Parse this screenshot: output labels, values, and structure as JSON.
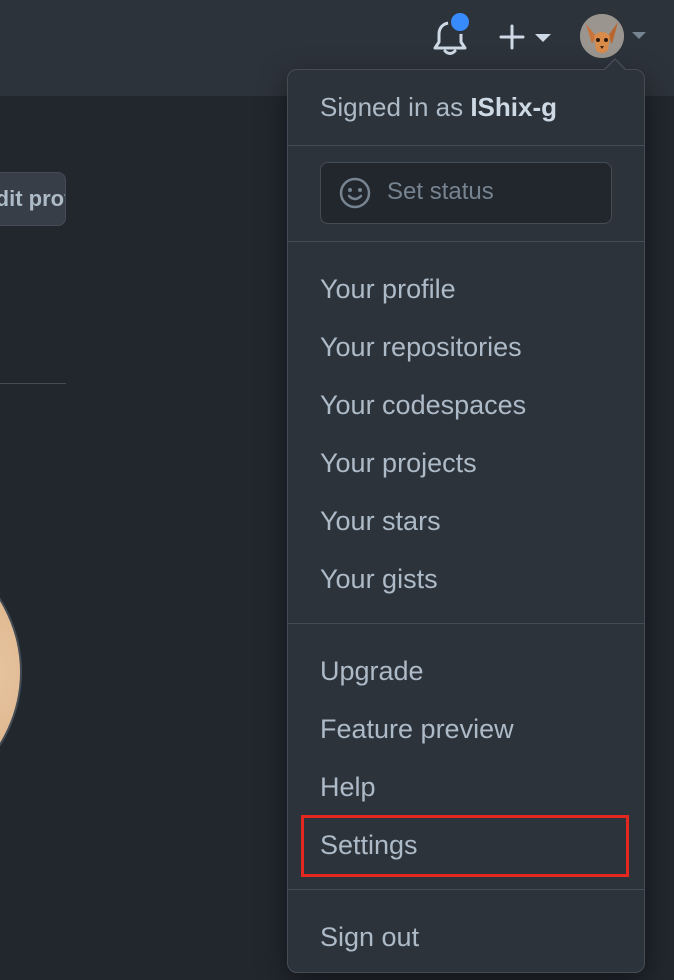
{
  "header": {
    "notifications_icon": "bell-icon",
    "create_icon": "plus-icon",
    "user_icon": "avatar"
  },
  "background": {
    "edit_profile_label": "Edit profile"
  },
  "dropdown": {
    "signed_in_prefix": "Signed in as",
    "username": "IShix-g",
    "set_status_placeholder": "Set status",
    "menu_section_1": [
      "Your profile",
      "Your repositories",
      "Your codespaces",
      "Your projects",
      "Your stars",
      "Your gists"
    ],
    "menu_section_2": [
      "Upgrade",
      "Feature preview",
      "Help",
      "Settings"
    ],
    "sign_out": "Sign out"
  },
  "colors": {
    "background": "#22272e",
    "panel": "#2d333b",
    "border": "#444c56",
    "text": "#adbac7",
    "notification_dot": "#388bfd",
    "highlight_box": "#e5281f"
  }
}
